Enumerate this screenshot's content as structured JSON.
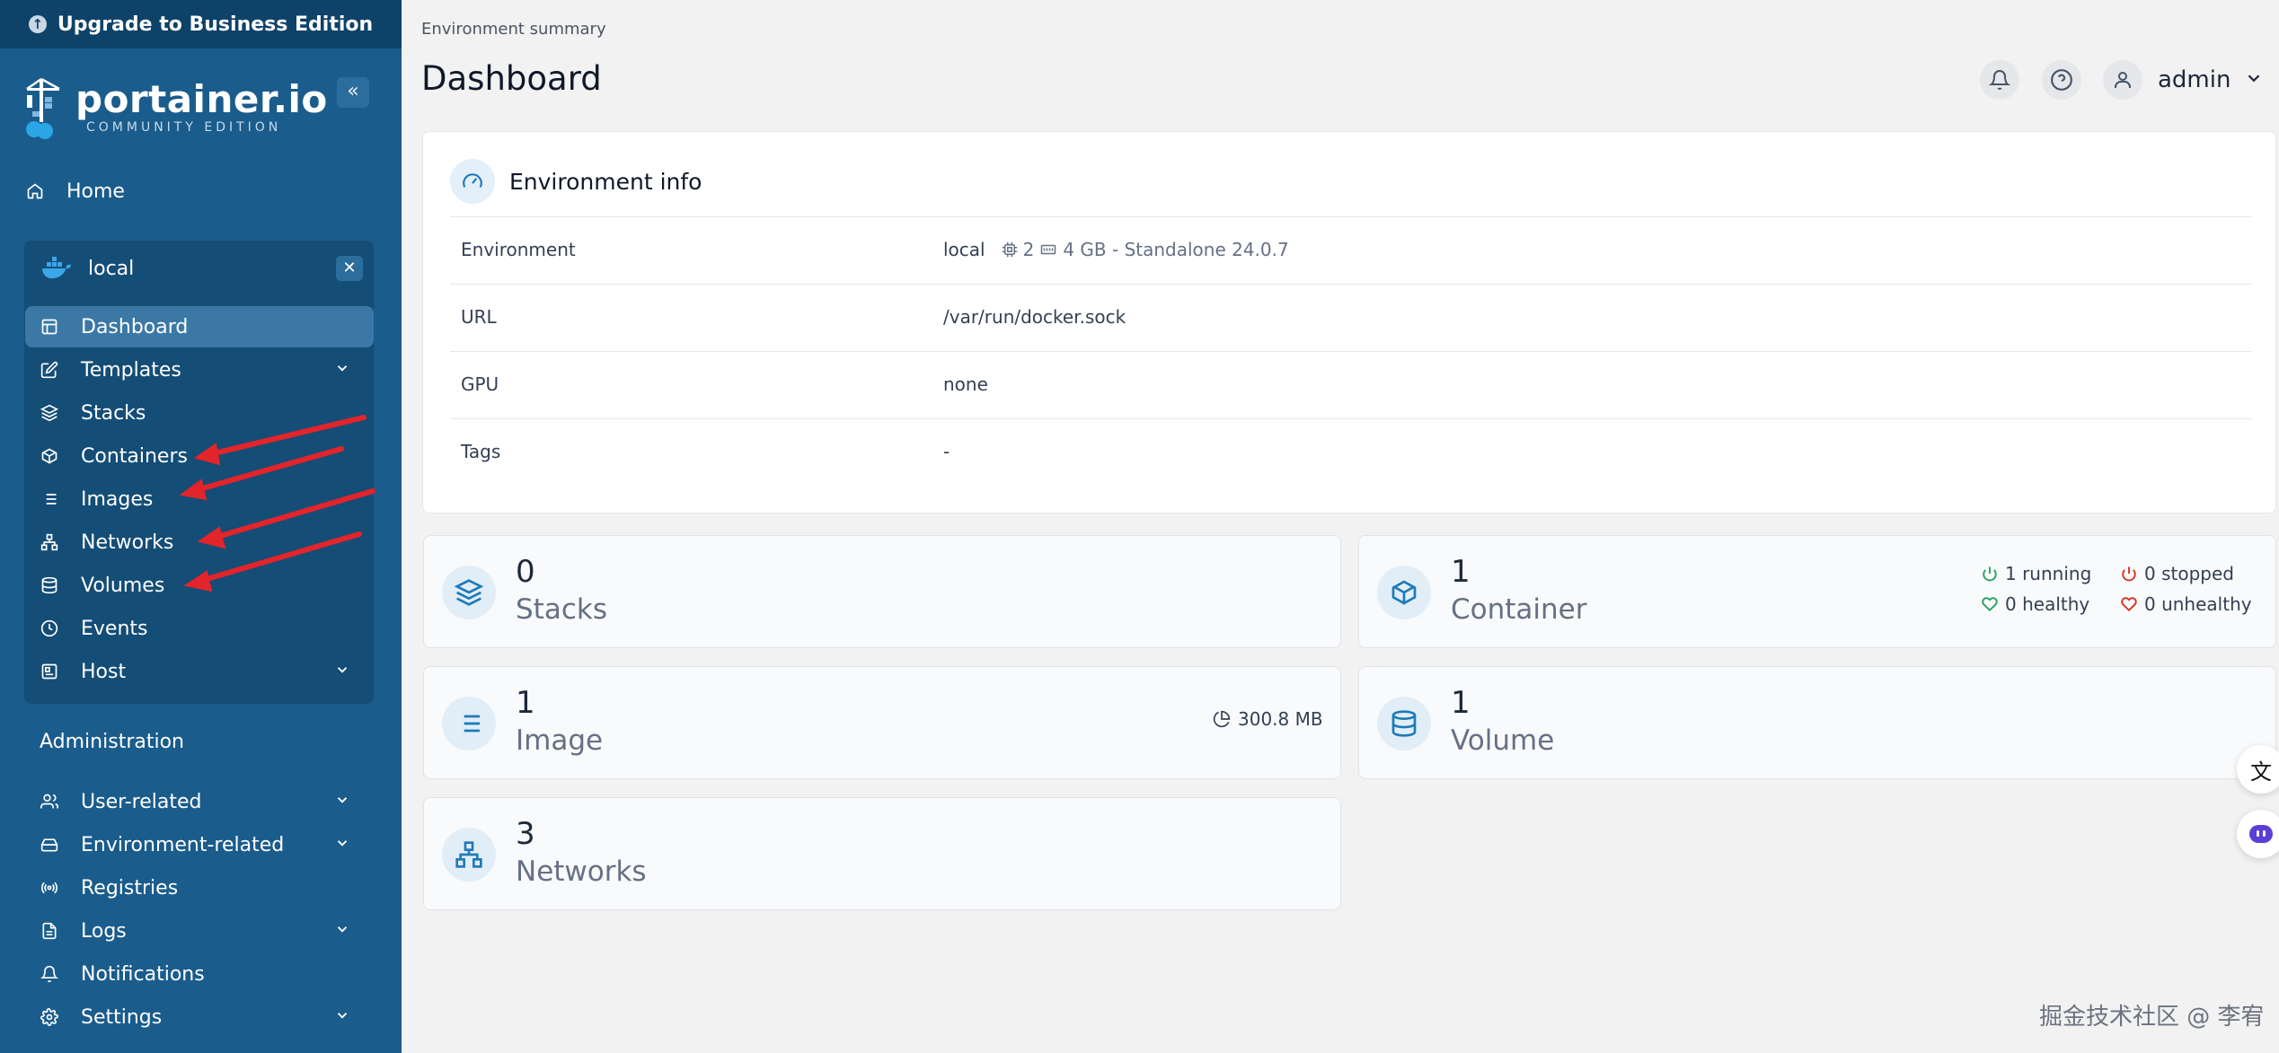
{
  "sidebar": {
    "upgrade_label": "Upgrade to Business Edition",
    "logo_name": "portainer.io",
    "logo_edition": "COMMUNITY EDITION",
    "home_label": "Home",
    "environment_name": "local",
    "env_items": [
      {
        "label": "Dashboard",
        "icon": "dashboard-icon"
      },
      {
        "label": "Templates",
        "icon": "edit-icon"
      },
      {
        "label": "Stacks",
        "icon": "layers-icon"
      },
      {
        "label": "Containers",
        "icon": "box-icon"
      },
      {
        "label": "Images",
        "icon": "list-icon"
      },
      {
        "label": "Networks",
        "icon": "network-icon"
      },
      {
        "label": "Volumes",
        "icon": "database-icon"
      },
      {
        "label": "Events",
        "icon": "clock-icon"
      },
      {
        "label": "Host",
        "icon": "server-icon"
      }
    ],
    "administration_title": "Administration",
    "admin_items": [
      {
        "label": "User-related",
        "icon": "users-icon"
      },
      {
        "label": "Environment-related",
        "icon": "hard-drive-icon"
      },
      {
        "label": "Registries",
        "icon": "radio-icon"
      },
      {
        "label": "Logs",
        "icon": "file-text-icon"
      },
      {
        "label": "Notifications",
        "icon": "bell-icon"
      },
      {
        "label": "Settings",
        "icon": "settings-icon"
      }
    ]
  },
  "header": {
    "breadcrumb": "Environment summary",
    "title": "Dashboard",
    "username": "admin"
  },
  "environment_info": {
    "title": "Environment info",
    "rows": [
      {
        "key": "Environment",
        "name": "local",
        "cpu": "2",
        "memory": "4 GB - Standalone 24.0.7"
      },
      {
        "key": "URL",
        "value": "/var/run/docker.sock"
      },
      {
        "key": "GPU",
        "value": "none"
      },
      {
        "key": "Tags",
        "value": "-"
      }
    ]
  },
  "stats": {
    "stacks": {
      "count": "0",
      "label": "Stacks"
    },
    "containers": {
      "count": "1",
      "label": "Container",
      "running": "1 running",
      "stopped": "0 stopped",
      "healthy": "0 healthy",
      "unhealthy": "0 unhealthy"
    },
    "images": {
      "count": "1",
      "label": "Image",
      "size": "300.8 MB"
    },
    "volumes": {
      "count": "1",
      "label": "Volume"
    },
    "networks": {
      "count": "3",
      "label": "Networks"
    }
  },
  "colors": {
    "sidebar": "#1a5c8c",
    "sidebar_dark": "#0e4268",
    "accent": "#1f7ab8",
    "running": "#22a35a",
    "stopped": "#d92d20",
    "annotation_arrow": "#e3242b"
  },
  "watermark": "掘金技术社区 @ 李宥"
}
